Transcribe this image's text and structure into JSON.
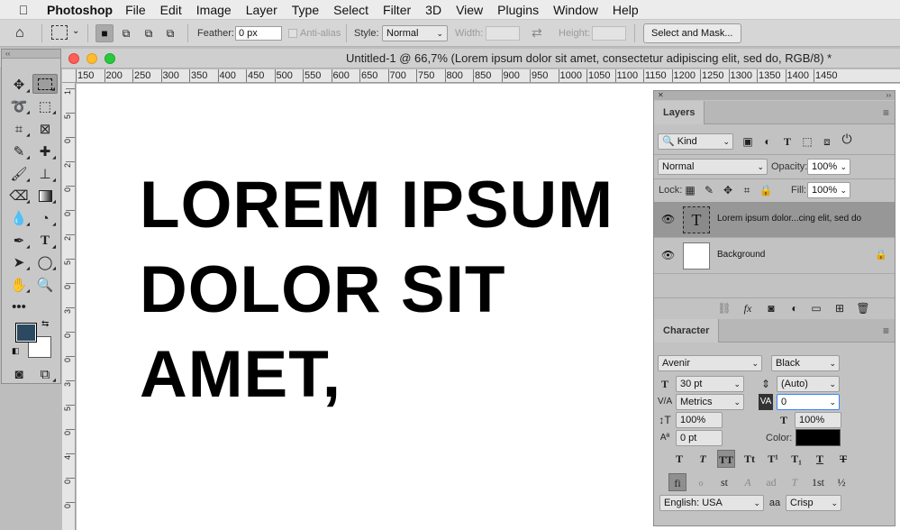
{
  "menubar": {
    "apple_glyph": "",
    "app_name": "Photoshop",
    "menus": [
      "File",
      "Edit",
      "Image",
      "Layer",
      "Type",
      "Select",
      "Filter",
      "3D",
      "View",
      "Plugins",
      "Window",
      "Help"
    ]
  },
  "options_bar": {
    "feather_label": "Feather:",
    "feather_value": "0 px",
    "antialias_label": "Anti-alias",
    "style_label": "Style:",
    "style_value": "Normal",
    "width_label": "Width:",
    "height_label": "Height:",
    "select_mask_label": "Select and Mask..."
  },
  "document": {
    "title": "Untitled-1 @ 66,7% (Lorem ipsum dolor sit amet, consectetur adipiscing elit, sed do, RGB/8) *",
    "canvas_lines": [
      "LOREM IPSUM",
      "DOLOR SIT",
      "AMET,"
    ],
    "ruler_top": [
      "150",
      "200",
      "250",
      "300",
      "350",
      "400",
      "450",
      "500",
      "550",
      "600",
      "650",
      "700",
      "750",
      "800",
      "850",
      "900",
      "950",
      "1000",
      "1050",
      "1100",
      "1150",
      "1200",
      "1250",
      "1300",
      "1350",
      "1400",
      "1450"
    ],
    "ruler_left": [
      "1",
      "5",
      "0",
      "2",
      "0",
      "0",
      "2",
      "5",
      "0",
      "3",
      "0",
      "0",
      "3",
      "5",
      "0",
      "4",
      "0",
      "0"
    ]
  },
  "layers_panel": {
    "tab": "Layers",
    "filter_kind": "Kind",
    "blend_mode": "Normal",
    "opacity_label": "Opacity:",
    "opacity_value": "100%",
    "lock_label": "Lock:",
    "fill_label": "Fill:",
    "fill_value": "100%",
    "layers": [
      {
        "name": "Lorem ipsum dolor...cing elit, sed do",
        "thumb": "T",
        "selected": true
      },
      {
        "name": "Background",
        "thumb": "",
        "selected": false
      }
    ],
    "bottom_icons": [
      "link-icon",
      "fx-icon",
      "mask-icon",
      "adjustment-icon",
      "folder-icon",
      "new-layer-icon",
      "trash-icon"
    ],
    "fx_text": "fx"
  },
  "character_panel": {
    "tab": "Character",
    "font_family": "Avenir",
    "font_style": "Black",
    "font_size": "30 pt",
    "leading": "(Auto)",
    "kerning": "Metrics",
    "tracking": "0",
    "vertical_scale": "100%",
    "horizontal_scale": "100%",
    "baseline_shift": "0 pt",
    "color_label": "Color:",
    "color_value": "#000000",
    "language": "English: USA",
    "antialias_icon_text": "aa",
    "antialias": "Crisp",
    "style_buttons": [
      "T",
      "T",
      "TT",
      "Tt",
      "T¹",
      "T₁",
      "T",
      "T"
    ],
    "opentype_buttons": [
      "fi",
      "ℴ",
      "st",
      "A",
      "ad",
      "T",
      "1st",
      "½"
    ]
  },
  "colors": {
    "foreground": "#2b4a62",
    "background": "#ffffff"
  }
}
